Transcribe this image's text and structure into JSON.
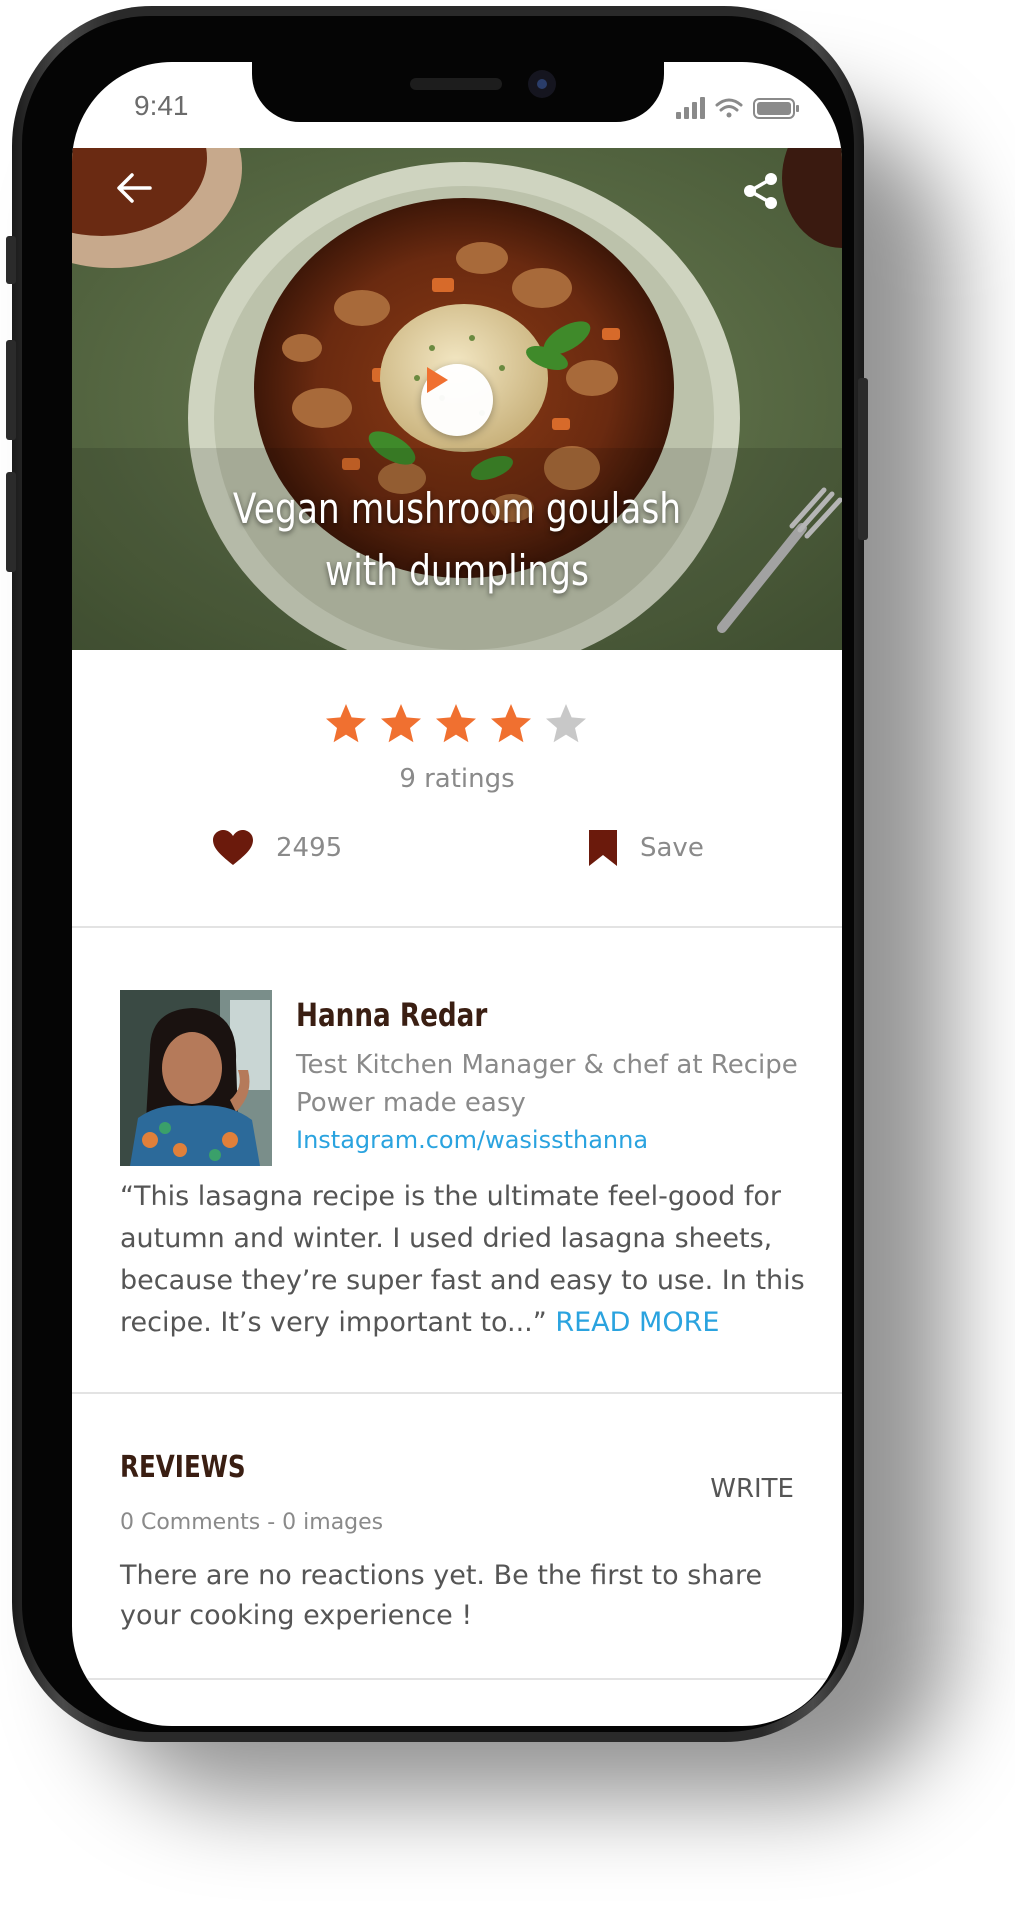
{
  "status_bar": {
    "time": "9:41"
  },
  "recipe": {
    "title": "Vegan mushroom goulash with dumplings",
    "rating": {
      "value": 4,
      "max": 5,
      "count_label": "9 ratings"
    },
    "likes": "2495",
    "save_label": "Save"
  },
  "author": {
    "name": "Hanna Redar",
    "role": "Test Kitchen Manager & chef at Recipe Power made easy",
    "link": "Instagram.com/wasissthanna"
  },
  "quote": {
    "text": "“This lasagna recipe is the ultimate feel-good for autumn and winter. I used dried lasagna sheets, because they’re super fast and easy to use. In this recipe. It’s very important to...”",
    "read_more": "READ MORE"
  },
  "reviews": {
    "title": "REVIEWS",
    "write_label": "WRITE",
    "meta": "0 Comments - 0 images",
    "empty_text": "There are no reactions yet. Be the first to share your cooking experience !"
  },
  "colors": {
    "star_active": "#f07030",
    "star_inactive": "#c8c8c8",
    "action_icon": "#6b1a0c",
    "link": "#2aa3df",
    "heading": "#3a1e12"
  },
  "icons": {
    "back": "arrow-left-icon",
    "share": "share-icon",
    "play": "play-icon",
    "like": "heart-icon",
    "save": "bookmark-icon"
  }
}
